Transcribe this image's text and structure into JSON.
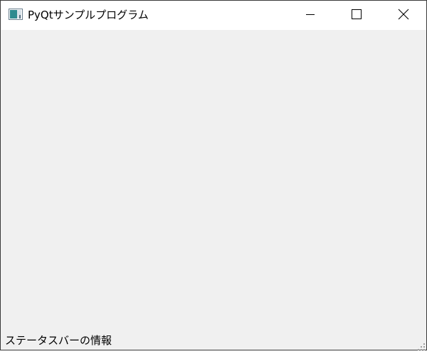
{
  "window": {
    "title": "PyQtサンプルプログラム",
    "app_icon": "pyqt-window-icon",
    "controls": {
      "minimize_icon": "minimize-icon",
      "maximize_icon": "maximize-icon",
      "close_icon": "close-icon"
    }
  },
  "statusbar": {
    "message": "ステータスバーの情報",
    "grip_icon": "size-grip-icon"
  },
  "colors": {
    "titlebar_bg": "#ffffff",
    "client_bg": "#f0f0f0",
    "window_border": "#3a3a3a"
  }
}
